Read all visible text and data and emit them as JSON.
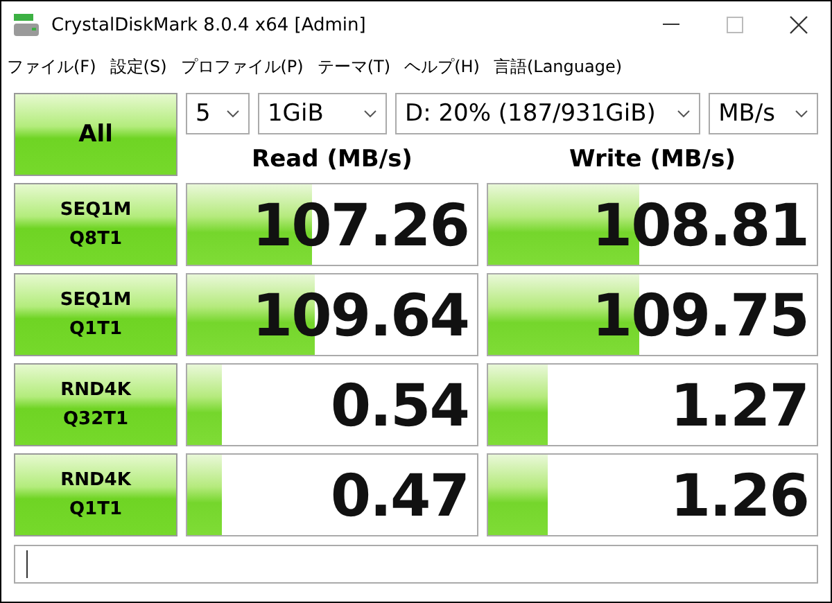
{
  "window": {
    "title": "CrystalDiskMark 8.0.4 x64 [Admin]"
  },
  "menu": [
    "ファイル(F)",
    "設定(S)",
    "プロファイル(P)",
    "テーマ(T)",
    "ヘルプ(H)",
    "言語(Language)"
  ],
  "all_button": "All",
  "selectors": [
    {
      "value": "5"
    },
    {
      "value": "1GiB"
    },
    {
      "value": "D: 20% (187/931GiB)"
    },
    {
      "value": "MB/s"
    }
  ],
  "headers": [
    "Read (MB/s)",
    "Write (MB/s)"
  ],
  "rows": [
    {
      "test": [
        "SEQ1M",
        "Q8T1"
      ],
      "read": {
        "value": "107.26",
        "level": 0.43
      },
      "write": {
        "value": "108.81",
        "level": 0.46
      }
    },
    {
      "test": [
        "SEQ1M",
        "Q1T1"
      ],
      "read": {
        "value": "109.64",
        "level": 0.44
      },
      "write": {
        "value": "109.75",
        "level": 0.46
      }
    },
    {
      "test": [
        "RND4K",
        "Q32T1"
      ],
      "read": {
        "value": "0.54",
        "level": 0.12
      },
      "write": {
        "value": "1.27",
        "level": 0.18
      }
    },
    {
      "test": [
        "RND4K",
        "Q1T1"
      ],
      "read": {
        "value": "0.47",
        "level": 0.12
      },
      "write": {
        "value": "1.26",
        "level": 0.18
      }
    }
  ]
}
